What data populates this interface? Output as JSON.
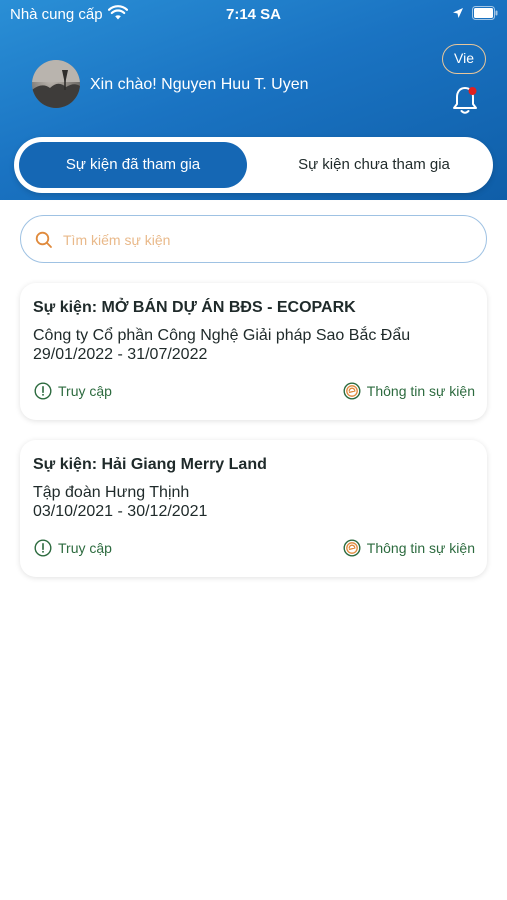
{
  "status_bar": {
    "carrier": "Nhà cung cấp",
    "time": "7:14 SA"
  },
  "header": {
    "greeting": "Xin chào! Nguyen Huu T. Uyen",
    "language": "Vie"
  },
  "tabs": {
    "joined": "Sự kiện đã tham gia",
    "not_joined": "Sự kiện chưa tham gia"
  },
  "search": {
    "placeholder": "Tìm kiếm sự kiện"
  },
  "events": [
    {
      "title": "Sự kiện: MỞ BÁN DỰ ÁN BĐS - ECOPARK",
      "company": "Công ty Cổ phần Công Nghệ Giải pháp Sao Bắc Đẩu",
      "dates": "29/01/2022 - 31/07/2022",
      "access_label": "Truy cập",
      "info_label": "Thông tin sự kiện"
    },
    {
      "title": "Sự kiện: Hải Giang Merry Land",
      "company": "Tập đoàn Hưng Thịnh",
      "dates": "03/10/2021 - 30/12/2021",
      "access_label": "Truy cập",
      "info_label": "Thông tin sự kiện"
    }
  ],
  "colors": {
    "header_blue": "#1a73c2",
    "active_tab": "#1567b4",
    "action_green": "#2d6b3f",
    "search_icon": "#e08a3c",
    "notification_dot": "#e02020"
  }
}
